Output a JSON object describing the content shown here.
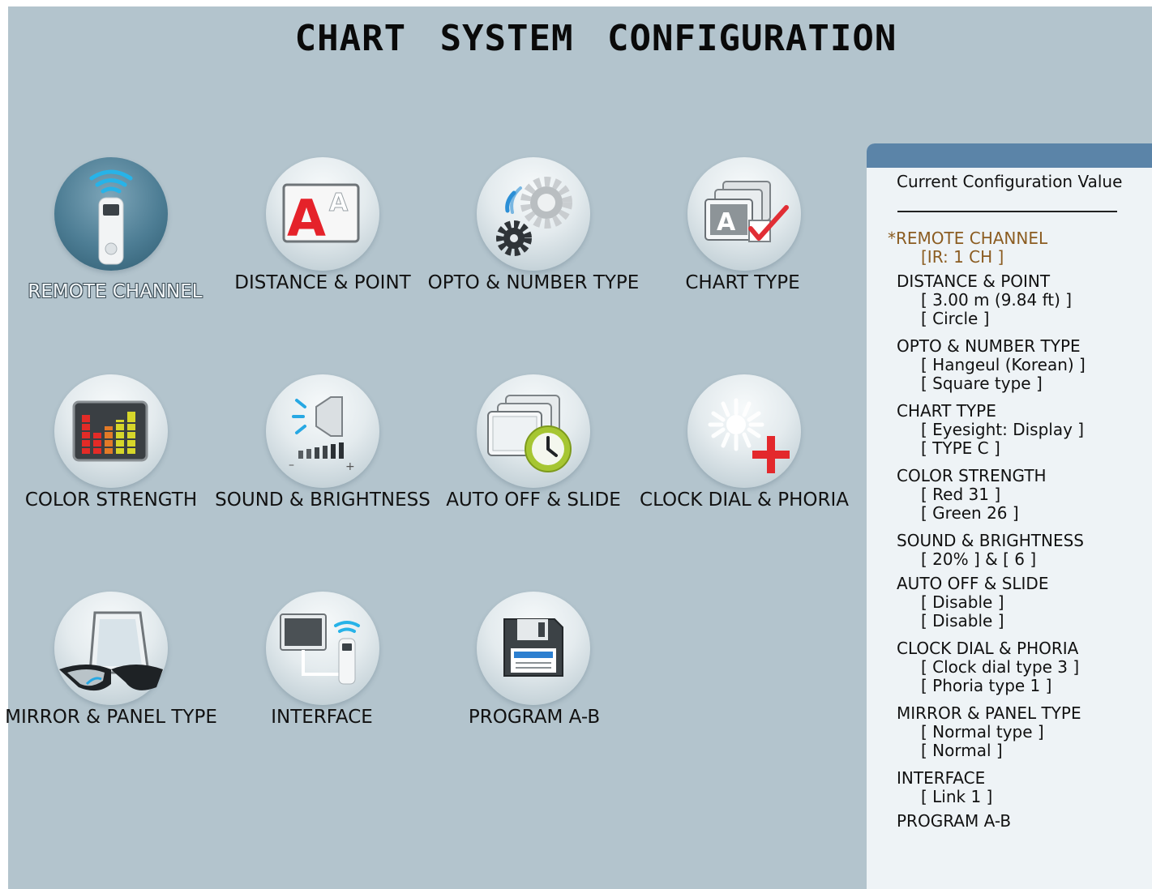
{
  "page_title": "CHART   SYSTEM   CONFIGURATION",
  "menu": {
    "items": [
      {
        "label": "REMOTE CHANNEL",
        "icon": "remote-control-icon",
        "active": true
      },
      {
        "label": "DISTANCE & POINT",
        "icon": "letter-size-icon",
        "active": false
      },
      {
        "label": "OPTO & NUMBER TYPE",
        "icon": "gears-icon",
        "active": false
      },
      {
        "label": "CHART TYPE",
        "icon": "chart-cards-check-icon",
        "active": false
      },
      {
        "label": "COLOR STRENGTH",
        "icon": "color-bars-icon",
        "active": false
      },
      {
        "label": "SOUND & BRIGHTNESS",
        "icon": "speaker-icon",
        "active": false
      },
      {
        "label": "AUTO OFF & SLIDE",
        "icon": "slides-clock-icon",
        "active": false
      },
      {
        "label": "CLOCK DIAL & PHORIA",
        "icon": "clock-dial-cross-icon",
        "active": false
      },
      {
        "label": "MIRROR & PANEL TYPE",
        "icon": "mirror-glasses-icon",
        "active": false
      },
      {
        "label": "INTERFACE",
        "icon": "monitor-remote-icon",
        "active": false
      },
      {
        "label": "PROGRAM A-B",
        "icon": "floppy-disk-icon",
        "active": false
      }
    ]
  },
  "config_panel": {
    "title": "Current Configuration Value",
    "lines": [
      {
        "text": "*REMOTE CHANNEL",
        "kind": "heading",
        "selected": true
      },
      {
        "text": "[IR: 1 CH ]",
        "kind": "value",
        "selected": true
      },
      {
        "text": "DISTANCE & POINT",
        "kind": "heading"
      },
      {
        "text": "[ 3.00 m  (9.84 ft) ]",
        "kind": "value"
      },
      {
        "text": "[ Circle ]",
        "kind": "value"
      },
      {
        "text": "OPTO & NUMBER TYPE",
        "kind": "heading"
      },
      {
        "text": "[ Hangeul (Korean) ]",
        "kind": "value"
      },
      {
        "text": "[ Square  type ]",
        "kind": "value"
      },
      {
        "text": "CHART TYPE",
        "kind": "heading"
      },
      {
        "text": "[ Eyesight:  Display ]",
        "kind": "value"
      },
      {
        "text": "[ TYPE C ]",
        "kind": "value"
      },
      {
        "text": "COLOR STRENGTH",
        "kind": "heading"
      },
      {
        "text": "[ Red  31 ]",
        "kind": "value"
      },
      {
        "text": "[ Green  26 ]",
        "kind": "value"
      },
      {
        "text": "SOUND & BRIGHTNESS",
        "kind": "heading"
      },
      {
        "text": "[ 20% ] & [ 6 ]",
        "kind": "value"
      },
      {
        "text": "AUTO OFF & SLIDE",
        "kind": "heading"
      },
      {
        "text": "[ Disable ]",
        "kind": "value"
      },
      {
        "text": "[ Disable ]",
        "kind": "value"
      },
      {
        "text": "CLOCK DIAL & PHORIA",
        "kind": "heading"
      },
      {
        "text": "[ Clock  dial  type  3 ]",
        "kind": "value"
      },
      {
        "text": "[ Phoria  type  1 ]",
        "kind": "value"
      },
      {
        "text": "MIRROR & PANEL TYPE",
        "kind": "heading"
      },
      {
        "text": "[ Normal  type ]",
        "kind": "value"
      },
      {
        "text": "[ Normal ]",
        "kind": "value"
      },
      {
        "text": "INTERFACE",
        "kind": "heading"
      },
      {
        "text": "[ Link 1 ]",
        "kind": "value"
      },
      {
        "text": "PROGRAM A-B",
        "kind": "heading"
      }
    ]
  },
  "colors": {
    "background": "#b3c4cd",
    "panel_background": "#eef3f6",
    "panel_header": "#5b84a8",
    "selected_text": "#8b5c21"
  }
}
